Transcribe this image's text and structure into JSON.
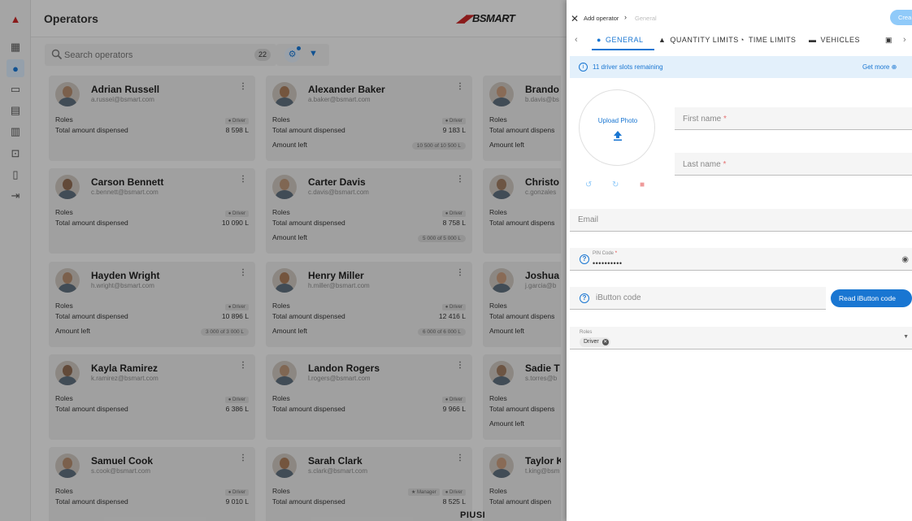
{
  "app": {
    "title": "Operators",
    "logo_prefix": "",
    "logo_brand": "BSMART",
    "footer_logo": "PIUSI",
    "search_placeholder": "Search operators",
    "count": "22",
    "filter_settings_icon": "filter-settings-icon",
    "filter_icon": "filter-icon",
    "rail_icons": [
      "fuel-drop-icon",
      "dashboard-icon",
      "operators-icon",
      "vehicles-icon",
      "tanks-icon",
      "reports-icon",
      "dispensers-icon",
      "inventory-icon",
      "logout-icon"
    ],
    "rail_active_index": 2
  },
  "labels": {
    "roles": "Roles",
    "total": "Total amount dispensed",
    "left": "Amount left"
  },
  "operators": [
    {
      "name": "Adrian Russell",
      "email": "a.russel@bsmart.com",
      "roles": [
        "Driver"
      ],
      "total": "8 598 L",
      "left": null
    },
    {
      "name": "Alexander Baker",
      "email": "a.baker@bsmart.com",
      "roles": [
        "Driver"
      ],
      "total": "9 183 L",
      "left": "10 500 of 10 500 L"
    },
    {
      "name": "Brando",
      "email": "b.davis@bs",
      "roles": [],
      "total": "",
      "left": "",
      "total_label": "Total amount dispens"
    },
    {
      "name": "Carson Bennett",
      "email": "c.bennett@bsmart.com",
      "roles": [
        "Driver"
      ],
      "total": "10 090 L",
      "left": null
    },
    {
      "name": "Carter Davis",
      "email": "c.davis@bsmart.com",
      "roles": [
        "Driver"
      ],
      "total": "8 758 L",
      "left": "5 000 of 5 000 L"
    },
    {
      "name": "Christo",
      "email": "c.gonzales",
      "roles": [],
      "total": "",
      "left": null,
      "total_label": "Total amount dispens"
    },
    {
      "name": "Hayden Wright",
      "email": "h.wright@bsmart.com",
      "roles": [
        "Driver"
      ],
      "total": "10 896 L",
      "left": "3 000 of 3 000 L"
    },
    {
      "name": "Henry Miller",
      "email": "h.miller@bsmart.com",
      "roles": [
        "Driver"
      ],
      "total": "12 416 L",
      "left": "6 000 of 6 000 L"
    },
    {
      "name": "Joshua",
      "email": "j.garcia@b",
      "roles": [],
      "total": "",
      "left": "",
      "total_label": "Total amount dispens"
    },
    {
      "name": "Kayla Ramirez",
      "email": "k.ramirez@bsmart.com",
      "roles": [
        "Driver"
      ],
      "total": "6 386 L",
      "left": null
    },
    {
      "name": "Landon Rogers",
      "email": "l.rogers@bsmart.com",
      "roles": [
        "Driver"
      ],
      "total": "9 966 L",
      "left": null
    },
    {
      "name": "Sadie T",
      "email": "s.torres@b",
      "roles": [],
      "total": "",
      "left": "",
      "total_label": "Total amount dispens"
    },
    {
      "name": "Samuel Cook",
      "email": "s.cook@bsmart.com",
      "roles": [
        "Driver"
      ],
      "total": "9 010 L",
      "left": null
    },
    {
      "name": "Sarah Clark",
      "email": "s.clark@bsmart.com",
      "roles": [
        "Manager",
        "Driver"
      ],
      "total": "8 525 L",
      "left": null
    },
    {
      "name": "Taylor K",
      "email": "t.king@bsm",
      "roles": [],
      "total": "",
      "left": null,
      "total_label": "Total amount dispen"
    }
  ],
  "panel": {
    "title": "Add operator",
    "crumb": "General",
    "create_label": "Crea",
    "tabs": [
      {
        "label": "GENERAL",
        "icon": "person-icon"
      },
      {
        "label": "QUANTITY LIMITS",
        "icon": "weight-icon"
      },
      {
        "label": "TIME LIMITS",
        "icon": "clock-icon"
      },
      {
        "label": "VEHICLES",
        "icon": "car-icon"
      }
    ],
    "slots_text": "11 driver slots remaining",
    "get_more": "Get more ⊕",
    "upload_label": "Upload Photo",
    "first_name": "First name",
    "last_name": "Last name",
    "required_mark": "*",
    "email_placeholder": "Email",
    "pin_label": "PIN Code",
    "pin_value": "••••••••••",
    "ibutton_placeholder": "iButton code",
    "read_button": "Read iButton code",
    "roles_label": "Roles",
    "role_chip": "Driver"
  },
  "colors": {
    "accent": "#1976d2",
    "danger": "#e53935",
    "slots_bg": "#e3f0fb"
  }
}
